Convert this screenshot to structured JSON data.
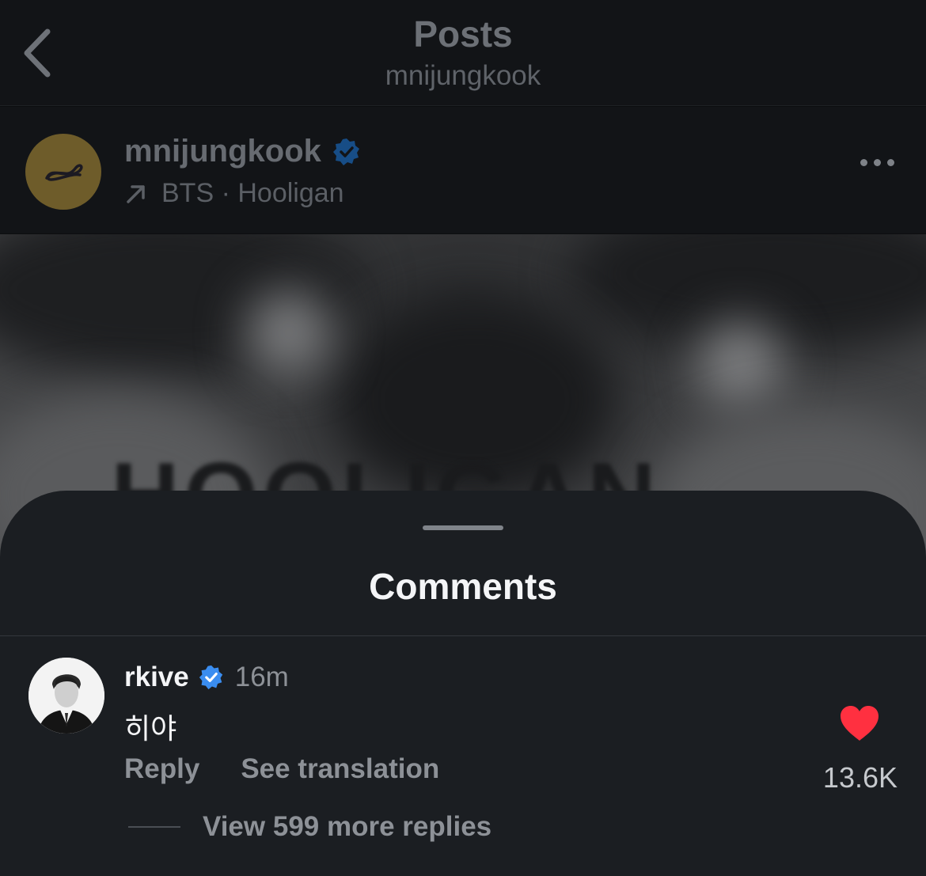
{
  "nav": {
    "title": "Posts",
    "subtitle": "mnijungkook",
    "back_icon": "chevron-left-icon"
  },
  "post": {
    "username": "mnijungkook",
    "verified": true,
    "music_artist": "BTS",
    "music_separator": "·",
    "music_track": "Hooligan",
    "media_text": "HOOLIGAN"
  },
  "comments_sheet": {
    "title": "Comments",
    "comment": {
      "username": "rkive",
      "verified": true,
      "time": "16m",
      "text": "히야",
      "reply_label": "Reply",
      "translate_label": "See translation",
      "like_count": "13.6K",
      "liked": true,
      "view_replies_label": "View 599 more replies"
    }
  },
  "colors": {
    "verified_blue": "#3a8df0",
    "like_red": "#ff3040",
    "sheet_bg": "#1b1e22"
  }
}
